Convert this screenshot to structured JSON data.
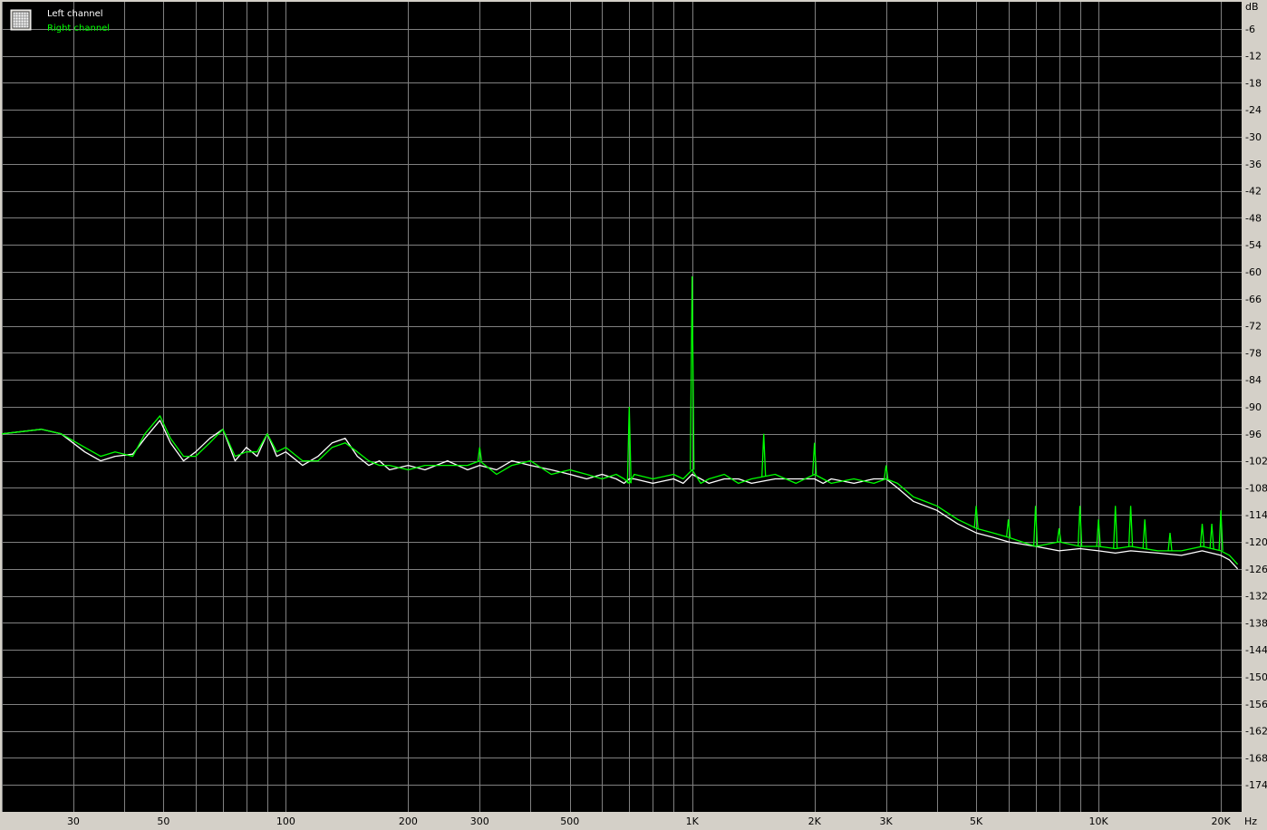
{
  "legend": {
    "icon": "grid-icon",
    "items": [
      {
        "label": "Left channel",
        "color": "#ffffff"
      },
      {
        "label": "Right channel",
        "color": "#00ff00"
      }
    ]
  },
  "colors": {
    "background": "#000000",
    "grid": "#808080",
    "frame": "#d4d0c8"
  },
  "chart_data": {
    "type": "line",
    "title": "",
    "xlabel": "",
    "ylabel": "",
    "x_unit": "Hz",
    "y_unit": "dB",
    "x_scale": "log",
    "xlim": [
      20,
      22500
    ],
    "ylim": [
      -180,
      0
    ],
    "x_ticks": [
      {
        "v": 30,
        "label": "30"
      },
      {
        "v": 50,
        "label": "50"
      },
      {
        "v": 100,
        "label": "100"
      },
      {
        "v": 200,
        "label": "200"
      },
      {
        "v": 300,
        "label": "300"
      },
      {
        "v": 500,
        "label": "500"
      },
      {
        "v": 1000,
        "label": "1K"
      },
      {
        "v": 2000,
        "label": "2K"
      },
      {
        "v": 3000,
        "label": "3K"
      },
      {
        "v": 5000,
        "label": "5K"
      },
      {
        "v": 10000,
        "label": "10K"
      },
      {
        "v": 20000,
        "label": "20K"
      }
    ],
    "y_ticks": [
      -6,
      -12,
      -18,
      -24,
      -30,
      -36,
      -42,
      -48,
      -54,
      -60,
      -66,
      -72,
      -78,
      -84,
      -90,
      -96,
      -102,
      -108,
      -114,
      -120,
      -126,
      -132,
      -138,
      -144,
      -150,
      -156,
      -162,
      -168,
      -174
    ],
    "grid": true,
    "legend_position": "top-left",
    "series": [
      {
        "name": "Left channel",
        "color": "#ffffff",
        "x": [
          20,
          25,
          28,
          32,
          35,
          38,
          42,
          45,
          49,
          52,
          56,
          60,
          65,
          70,
          75,
          80,
          85,
          90,
          95,
          100,
          110,
          120,
          130,
          140,
          150,
          160,
          170,
          180,
          200,
          220,
          250,
          280,
          300,
          330,
          360,
          400,
          450,
          500,
          550,
          600,
          650,
          680,
          700,
          720,
          800,
          900,
          950,
          1000,
          1050,
          1100,
          1200,
          1300,
          1400,
          1600,
          1800,
          2000,
          2100,
          2200,
          2500,
          2800,
          3000,
          3200,
          3500,
          4000,
          4500,
          5000,
          5500,
          6000,
          7000,
          8000,
          9000,
          10000,
          11000,
          12000,
          14000,
          16000,
          18000,
          20000,
          21000,
          22000
        ],
        "y": [
          -96,
          -95,
          -96,
          -100,
          -102,
          -101,
          -100.5,
          -97,
          -93,
          -98,
          -102,
          -100,
          -97,
          -95,
          -102,
          -99,
          -101,
          -96,
          -101,
          -100,
          -103,
          -101,
          -98,
          -97,
          -101,
          -103,
          -102,
          -104,
          -103,
          -104,
          -102,
          -104,
          -103,
          -104,
          -102,
          -103,
          -104,
          -105,
          -106,
          -105,
          -106,
          -107,
          -106,
          -106,
          -107,
          -106,
          -107,
          -105,
          -106,
          -107,
          -106,
          -106,
          -107,
          -106,
          -106,
          -106,
          -107,
          -106,
          -107,
          -106,
          -106,
          -108,
          -111,
          -113,
          -116,
          -118,
          -119,
          -120,
          -121,
          -122,
          -121.5,
          -122,
          -122.5,
          -122,
          -122.5,
          -123,
          -122,
          -123,
          -124,
          -126
        ]
      },
      {
        "name": "Right channel",
        "color": "#00ff00",
        "x": [
          20,
          25,
          28,
          32,
          35,
          38,
          42,
          45,
          49,
          52,
          56,
          60,
          65,
          70,
          75,
          80,
          85,
          90,
          95,
          100,
          110,
          120,
          130,
          140,
          150,
          160,
          170,
          180,
          200,
          220,
          250,
          280,
          300,
          330,
          360,
          400,
          450,
          500,
          550,
          600,
          650,
          680,
          700,
          720,
          800,
          900,
          950,
          1000,
          1050,
          1100,
          1200,
          1300,
          1400,
          1600,
          1800,
          2000,
          2100,
          2200,
          2500,
          2800,
          3000,
          3200,
          3500,
          4000,
          4500,
          5000,
          5500,
          6000,
          7000,
          8000,
          9000,
          10000,
          11000,
          12000,
          14000,
          16000,
          18000,
          20000,
          21000,
          22000
        ],
        "y": [
          -96,
          -95,
          -96,
          -99,
          -101,
          -100,
          -101,
          -96,
          -92,
          -97,
          -101,
          -101,
          -98,
          -95,
          -101,
          -100,
          -100,
          -96,
          -100,
          -99,
          -102,
          -102,
          -99,
          -98,
          -100,
          -102,
          -103,
          -103,
          -104,
          -103,
          -103,
          -103,
          -102,
          -105,
          -103,
          -102,
          -105,
          -104,
          -105,
          -106,
          -105,
          -106,
          -107,
          -105,
          -106,
          -105,
          -106,
          -104,
          -107,
          -106,
          -105,
          -107,
          -106,
          -105,
          -107,
          -105,
          -106,
          -107,
          -106,
          -107,
          -106,
          -107,
          -110,
          -112,
          -115,
          -117,
          -118,
          -119,
          -121,
          -120,
          -121,
          -121,
          -121.5,
          -121,
          -122,
          -122,
          -121,
          -122,
          -123,
          -125
        ]
      }
    ],
    "peaks": [
      {
        "x": 1000,
        "y": -61
      },
      {
        "x": 700,
        "y": -90
      },
      {
        "x": 300,
        "y": -99
      },
      {
        "x": 1500,
        "y": -96
      },
      {
        "x": 2000,
        "y": -98
      },
      {
        "x": 3000,
        "y": -103
      },
      {
        "x": 5000,
        "y": -112
      },
      {
        "x": 6000,
        "y": -115
      },
      {
        "x": 7000,
        "y": -112
      },
      {
        "x": 8000,
        "y": -117
      },
      {
        "x": 9000,
        "y": -112
      },
      {
        "x": 10000,
        "y": -115
      },
      {
        "x": 11000,
        "y": -112
      },
      {
        "x": 12000,
        "y": -112
      },
      {
        "x": 13000,
        "y": -115
      },
      {
        "x": 15000,
        "y": -118
      },
      {
        "x": 18000,
        "y": -116
      },
      {
        "x": 19000,
        "y": -116
      },
      {
        "x": 20000,
        "y": -113
      }
    ]
  }
}
